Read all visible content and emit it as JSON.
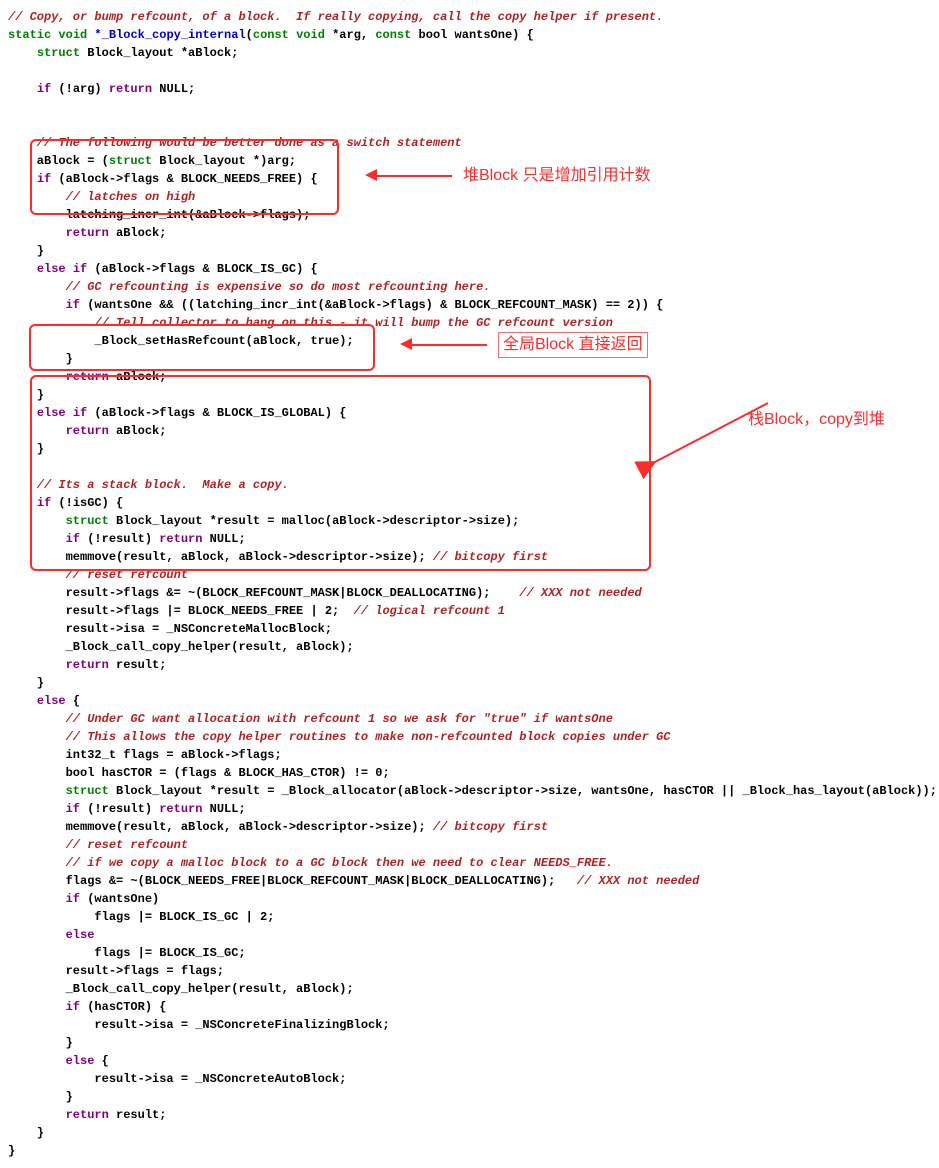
{
  "annotation": {
    "heap": "堆Block 只是增加引用计数",
    "global": "全局Block 直接返回",
    "stack": "栈Block，copy到堆"
  },
  "code": {
    "l01a": "// Copy, or bump refcount, of a block.  If really copying, call the copy helper if present.",
    "l02_kw1": "static",
    "l02_kw2": "void",
    "l02_fn": " *_Block_copy_internal",
    "l02_p1": "(",
    "l02_kw3": "const",
    "l02_kw4": "void",
    "l02_p2": " *arg, ",
    "l02_kw5": "const",
    "l02_p3": " bool wantsOne) {",
    "l03_kw1": "struct",
    "l03_r": " Block_layout *aBlock;",
    "blank": "",
    "l05_a": "    ",
    "l05_kw": "if",
    "l05_b": " (!arg) ",
    "l05_kw2": "return",
    "l05_c": " NULL;",
    "l08": "    // The following would be better done as a switch statement",
    "l09_a": "    aBlock = (",
    "l09_kw": "struct",
    "l09_b": " Block_layout *)arg;",
    "l10_kw": "if",
    "l10_b": " (aBlock->flags & BLOCK_NEEDS_FREE) {",
    "l11": "        // latches on high",
    "l12": "        latching_incr_int(&aBlock->flags);",
    "l13_kw": "return",
    "l13_b": " aBlock;",
    "l14": "    }",
    "l15_kw1": "else",
    "l15_kw2": "if",
    "l15_b": " (aBlock->flags & BLOCK_IS_GC) {",
    "l16": "        // GC refcounting is expensive so do most refcounting here.",
    "l17_kw": "if",
    "l17_b": " (wantsOne && ((latching_incr_int(&aBlock->flags) & BLOCK_REFCOUNT_MASK) == 2)) {",
    "l18": "            // Tell collector to hang on this - it will bump the GC refcount version",
    "l19": "            _Block_setHasRefcount(aBlock, true);",
    "l20": "        }",
    "l21_kw": "return",
    "l21_b": " aBlock;",
    "l22": "    }",
    "l23_kw1": "else",
    "l23_kw2": "if",
    "l23_b": " (aBlock->flags & BLOCK_IS_GLOBAL) {",
    "l24_kw": "return",
    "l24_b": " aBlock;",
    "l25": "    }",
    "l27": "    // Its a stack block.  Make a copy.",
    "l28_kw": "if",
    "l28_b": " (!isGC) {",
    "l29_kw": "struct",
    "l29_b": " Block_layout *result = malloc(aBlock->descriptor->size);",
    "l30_kw1": "if",
    "l30_b1": " (!result) ",
    "l30_kw2": "return",
    "l30_b2": " NULL;",
    "l31_a": "        memmove(result, aBlock, aBlock->descriptor->size); ",
    "l31_c": "// bitcopy first",
    "l32": "        // reset refcount",
    "l33_a": "        result->flags &= ~(BLOCK_REFCOUNT_MASK|BLOCK_DEALLOCATING);    ",
    "l33_c": "// XXX not needed",
    "l34_a": "        result->flags |= BLOCK_NEEDS_FREE | 2;  ",
    "l34_c": "// logical refcount 1",
    "l35": "        result->isa = _NSConcreteMallocBlock;",
    "l36": "        _Block_call_copy_helper(result, aBlock);",
    "l37_kw": "return",
    "l37_b": " result;",
    "l38": "    }",
    "l39_kw": "else",
    "l39_b": " {",
    "l40": "        // Under GC want allocation with refcount 1 so we ask for \"true\" if wantsOne",
    "l41": "        // This allows the copy helper routines to make non-refcounted block copies under GC",
    "l42": "        int32_t flags = aBlock->flags;",
    "l43": "        bool hasCTOR = (flags & BLOCK_HAS_CTOR) != 0;",
    "l44_kw": "struct",
    "l44_b": " Block_layout *result = _Block_allocator(aBlock->descriptor->size, wantsOne, hasCTOR || _Block_has_layout(aBlock));",
    "l45_kw1": "if",
    "l45_b1": " (!result) ",
    "l45_kw2": "return",
    "l45_b2": " NULL;",
    "l46_a": "        memmove(result, aBlock, aBlock->descriptor->size); ",
    "l46_c": "// bitcopy first",
    "l47": "        // reset refcount",
    "l48": "        // if we copy a malloc block to a GC block then we need to clear NEEDS_FREE.",
    "l49_a": "        flags &= ~(BLOCK_NEEDS_FREE|BLOCK_REFCOUNT_MASK|BLOCK_DEALLOCATING);   ",
    "l49_c": "// XXX not needed",
    "l50_kw": "if",
    "l50_b": " (wantsOne)",
    "l51": "            flags |= BLOCK_IS_GC | 2;",
    "l52_kw": "else",
    "l53": "            flags |= BLOCK_IS_GC;",
    "l54": "        result->flags = flags;",
    "l55": "        _Block_call_copy_helper(result, aBlock);",
    "l56_kw": "if",
    "l56_b": " (hasCTOR) {",
    "l57": "            result->isa = _NSConcreteFinalizingBlock;",
    "l58": "        }",
    "l59_kw": "else",
    "l59_b": " {",
    "l60": "            result->isa = _NSConcreteAutoBlock;",
    "l61": "        }",
    "l62_kw": "return",
    "l62_b": " result;",
    "l63": "    }",
    "l64": "}"
  }
}
